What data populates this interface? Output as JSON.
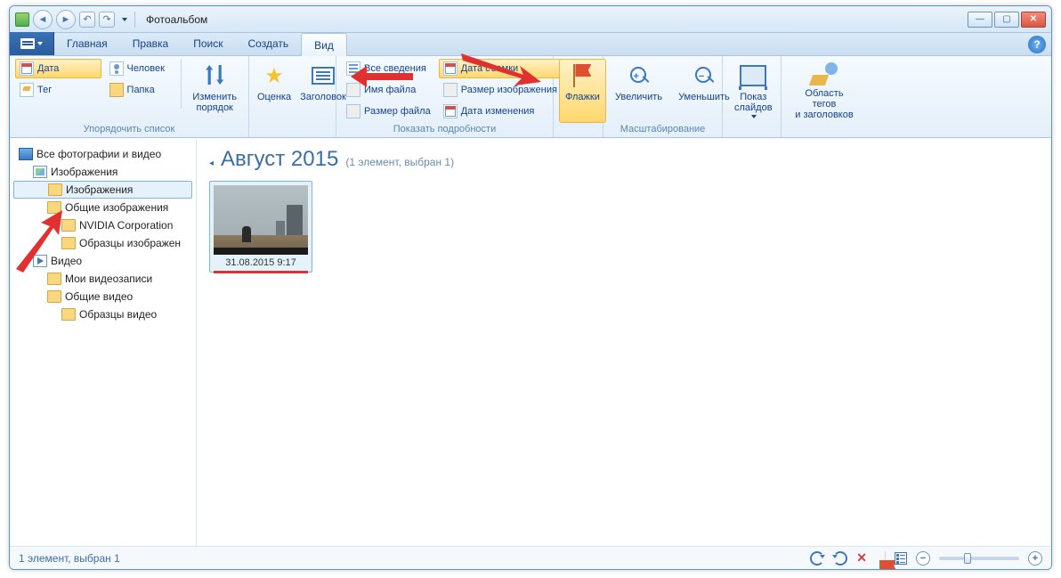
{
  "window": {
    "title": "Фотоальбом"
  },
  "menu": {
    "tabs": [
      "Главная",
      "Правка",
      "Поиск",
      "Создать",
      "Вид"
    ],
    "active_index": 4
  },
  "ribbon": {
    "arrange": {
      "date": "Дата",
      "tag": "Тег",
      "person": "Человек",
      "folder": "Папка",
      "reorder": "Изменить\nпорядок",
      "group_label": "Упорядочить список"
    },
    "rate": {
      "rating": "Оценка",
      "title": "Заголовок"
    },
    "details": {
      "all_details": "Все сведения",
      "filename": "Имя файла",
      "filesize": "Размер файла",
      "date_taken": "Дата съемки",
      "image_size": "Размер изображения",
      "date_modified": "Дата изменения",
      "group_label": "Показать подробности"
    },
    "flags": {
      "label": "Флажки"
    },
    "zoom": {
      "in": "Увеличить",
      "out": "Уменьшить",
      "group_label": "Масштабирование"
    },
    "slideshow": {
      "label": "Показ\nслайдов"
    },
    "tagpane": {
      "label": "Область тегов\nи заголовков"
    }
  },
  "sidebar": {
    "items": [
      {
        "label": "Все фотографии и видео",
        "icon": "ic-all",
        "indent": 0
      },
      {
        "label": "Изображения",
        "icon": "ic-pic",
        "indent": 1
      },
      {
        "label": "Изображения",
        "icon": "ic-folder",
        "indent": 2,
        "selected": true
      },
      {
        "label": "Общие изображения",
        "icon": "ic-folder",
        "indent": 2
      },
      {
        "label": "NVIDIA Corporation",
        "icon": "ic-folder",
        "indent": 3
      },
      {
        "label": "Образцы изображен",
        "icon": "ic-folder",
        "indent": 3
      },
      {
        "label": "Видео",
        "icon": "ic-video",
        "indent": 1
      },
      {
        "label": "Мои видеозаписи",
        "icon": "ic-folder",
        "indent": 2
      },
      {
        "label": "Общие видео",
        "icon": "ic-folder",
        "indent": 2
      },
      {
        "label": "Образцы видео",
        "icon": "ic-folder",
        "indent": 3
      }
    ]
  },
  "gallery": {
    "group_title": "Август 2015",
    "group_count": "(1 элемент, выбран 1)",
    "thumb_caption": "31.08.2015 9:17"
  },
  "statusbar": {
    "text": "1 элемент, выбран 1"
  }
}
